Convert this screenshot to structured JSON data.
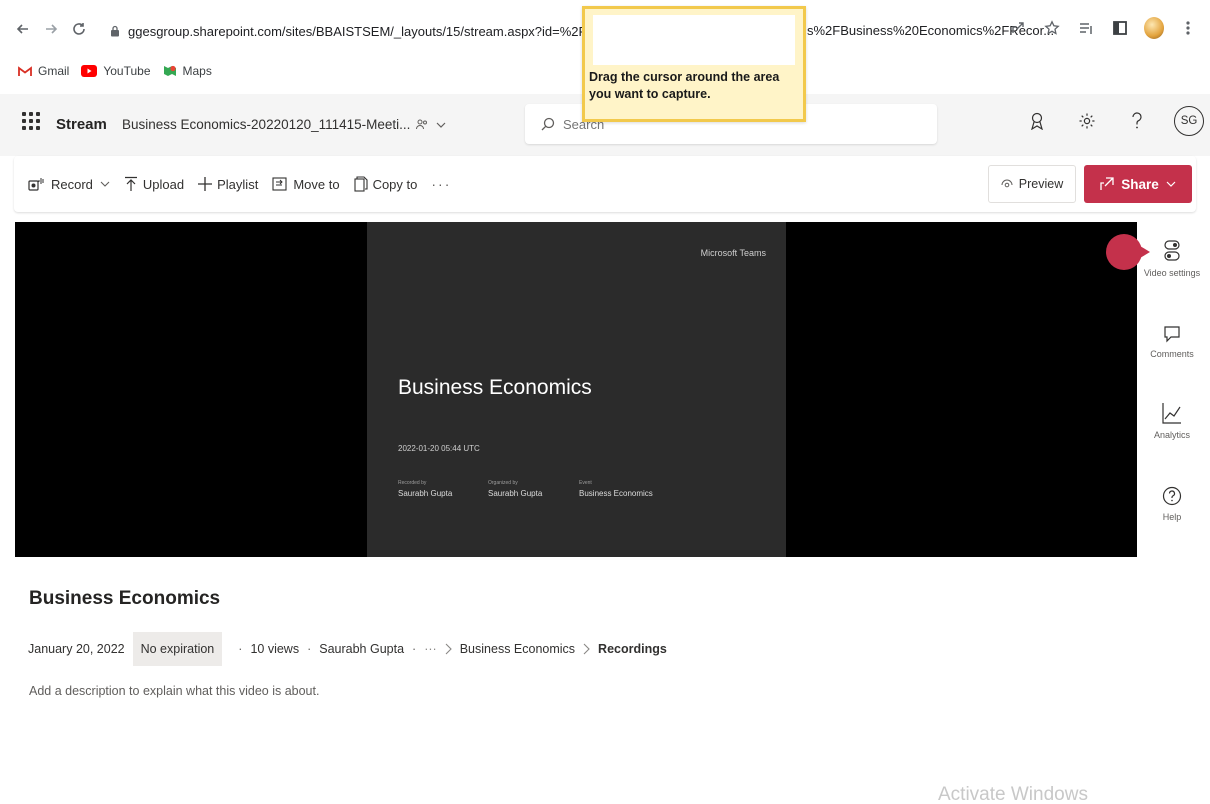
{
  "browser": {
    "url_left": "ggesgroup.sharepoint.com/sites/BBAISTSEM/_layouts/15/stream.aspx?id=%2Fsites",
    "url_right": "s%2FBusiness%20Economics%2FRecor...",
    "bookmarks": [
      {
        "label": "Gmail",
        "icon": "gmail-icon"
      },
      {
        "label": "YouTube",
        "icon": "youtube-icon"
      },
      {
        "label": "Maps",
        "icon": "maps-icon"
      }
    ]
  },
  "snip_tooltip": {
    "text": "Drag the cursor around the area you want to capture."
  },
  "header": {
    "app_name": "Stream",
    "doc_name": "Business Economics-20220120_111415-Meeti...",
    "search_placeholder": "Search",
    "avatar_initials": "SG"
  },
  "commands": {
    "record": "Record",
    "upload": "Upload",
    "playlist": "Playlist",
    "move_to": "Move to",
    "copy_to": "Copy to",
    "more": "···",
    "preview": "Preview",
    "share": "Share"
  },
  "slide": {
    "brand": "Microsoft Teams",
    "title": "Business Economics",
    "date": "2022-01-20 05:44 UTC",
    "meta": [
      {
        "label": "Recorded by",
        "value": "Saurabh Gupta"
      },
      {
        "label": "Organized by",
        "value": "Saurabh Gupta"
      },
      {
        "label": "Event",
        "value": "Business Economics"
      }
    ]
  },
  "rail": {
    "video_settings": "Video settings",
    "comments": "Comments",
    "analytics": "Analytics",
    "help": "Help"
  },
  "video": {
    "title": "Business Economics",
    "date": "January 20, 2022",
    "expiration": "No expiration",
    "views": "10 views",
    "owner": "Saurabh Gupta",
    "crumb_more": "···",
    "crumb_folder": "Business Economics",
    "crumb_current": "Recordings",
    "description_placeholder": "Add a description to explain what this video is about."
  },
  "watermark": "Activate Windows",
  "colors": {
    "accent": "#c4314b",
    "header_bg": "#f5f5f5",
    "video_bg": "#000000",
    "slide_bg": "#2b2b2b",
    "tooltip_bg": "#fff4c8",
    "tooltip_border": "#f2c94c"
  }
}
